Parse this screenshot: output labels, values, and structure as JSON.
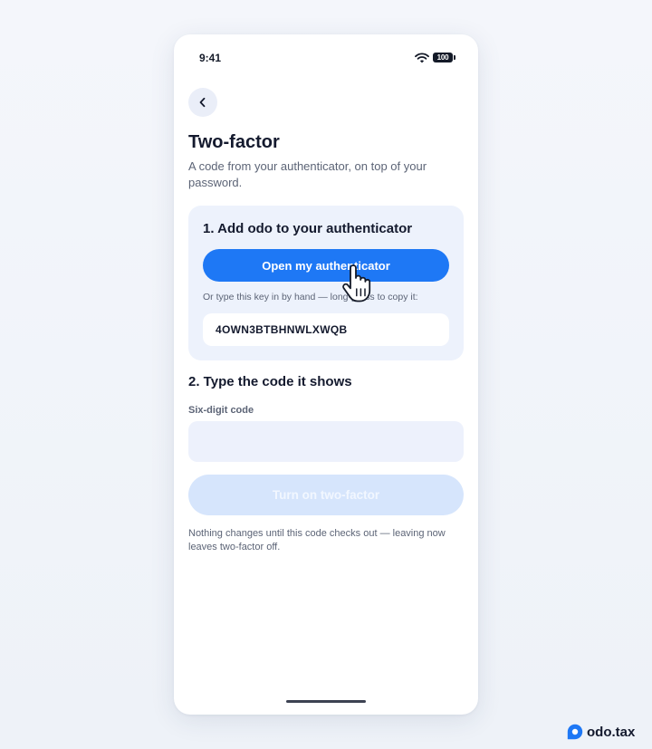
{
  "status_bar": {
    "time": "9:41",
    "battery": "100"
  },
  "nav": {
    "back_icon": "chevron-left-icon"
  },
  "header": {
    "title": "Two-factor",
    "subtitle": "A code from your authenticator, on top of your password."
  },
  "step1": {
    "title": "1. Add odo to your authenticator",
    "button_label": "Open my authenticator",
    "hint": "Or type this key in by hand — long-press to copy it:",
    "secret_key": "4OWN3BTBHNWLXWQB"
  },
  "step2": {
    "title": "2. Type the code it shows",
    "field_label": "Six-digit code",
    "field_value": "",
    "submit_label": "Turn on two-factor"
  },
  "footnote": "Nothing changes until this code checks out — leaving now leaves two-factor off.",
  "brand": {
    "name": "odo.tax"
  },
  "colors": {
    "accent": "#1e78f5",
    "card_background": "#edf2fc",
    "disabled_button": "#d6e5fc",
    "text_primary": "#141a2e",
    "text_secondary": "#5c6476"
  }
}
